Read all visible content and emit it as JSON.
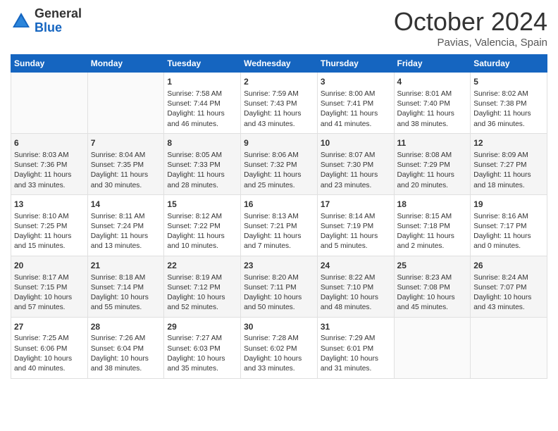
{
  "header": {
    "logo_general": "General",
    "logo_blue": "Blue",
    "month_title": "October 2024",
    "location": "Pavias, Valencia, Spain"
  },
  "days_of_week": [
    "Sunday",
    "Monday",
    "Tuesday",
    "Wednesday",
    "Thursday",
    "Friday",
    "Saturday"
  ],
  "weeks": [
    [
      {
        "day": "",
        "sunrise": "",
        "sunset": "",
        "daylight": ""
      },
      {
        "day": "",
        "sunrise": "",
        "sunset": "",
        "daylight": ""
      },
      {
        "day": "1",
        "sunrise": "Sunrise: 7:58 AM",
        "sunset": "Sunset: 7:44 PM",
        "daylight": "Daylight: 11 hours and 46 minutes."
      },
      {
        "day": "2",
        "sunrise": "Sunrise: 7:59 AM",
        "sunset": "Sunset: 7:43 PM",
        "daylight": "Daylight: 11 hours and 43 minutes."
      },
      {
        "day": "3",
        "sunrise": "Sunrise: 8:00 AM",
        "sunset": "Sunset: 7:41 PM",
        "daylight": "Daylight: 11 hours and 41 minutes."
      },
      {
        "day": "4",
        "sunrise": "Sunrise: 8:01 AM",
        "sunset": "Sunset: 7:40 PM",
        "daylight": "Daylight: 11 hours and 38 minutes."
      },
      {
        "day": "5",
        "sunrise": "Sunrise: 8:02 AM",
        "sunset": "Sunset: 7:38 PM",
        "daylight": "Daylight: 11 hours and 36 minutes."
      }
    ],
    [
      {
        "day": "6",
        "sunrise": "Sunrise: 8:03 AM",
        "sunset": "Sunset: 7:36 PM",
        "daylight": "Daylight: 11 hours and 33 minutes."
      },
      {
        "day": "7",
        "sunrise": "Sunrise: 8:04 AM",
        "sunset": "Sunset: 7:35 PM",
        "daylight": "Daylight: 11 hours and 30 minutes."
      },
      {
        "day": "8",
        "sunrise": "Sunrise: 8:05 AM",
        "sunset": "Sunset: 7:33 PM",
        "daylight": "Daylight: 11 hours and 28 minutes."
      },
      {
        "day": "9",
        "sunrise": "Sunrise: 8:06 AM",
        "sunset": "Sunset: 7:32 PM",
        "daylight": "Daylight: 11 hours and 25 minutes."
      },
      {
        "day": "10",
        "sunrise": "Sunrise: 8:07 AM",
        "sunset": "Sunset: 7:30 PM",
        "daylight": "Daylight: 11 hours and 23 minutes."
      },
      {
        "day": "11",
        "sunrise": "Sunrise: 8:08 AM",
        "sunset": "Sunset: 7:29 PM",
        "daylight": "Daylight: 11 hours and 20 minutes."
      },
      {
        "day": "12",
        "sunrise": "Sunrise: 8:09 AM",
        "sunset": "Sunset: 7:27 PM",
        "daylight": "Daylight: 11 hours and 18 minutes."
      }
    ],
    [
      {
        "day": "13",
        "sunrise": "Sunrise: 8:10 AM",
        "sunset": "Sunset: 7:25 PM",
        "daylight": "Daylight: 11 hours and 15 minutes."
      },
      {
        "day": "14",
        "sunrise": "Sunrise: 8:11 AM",
        "sunset": "Sunset: 7:24 PM",
        "daylight": "Daylight: 11 hours and 13 minutes."
      },
      {
        "day": "15",
        "sunrise": "Sunrise: 8:12 AM",
        "sunset": "Sunset: 7:22 PM",
        "daylight": "Daylight: 11 hours and 10 minutes."
      },
      {
        "day": "16",
        "sunrise": "Sunrise: 8:13 AM",
        "sunset": "Sunset: 7:21 PM",
        "daylight": "Daylight: 11 hours and 7 minutes."
      },
      {
        "day": "17",
        "sunrise": "Sunrise: 8:14 AM",
        "sunset": "Sunset: 7:19 PM",
        "daylight": "Daylight: 11 hours and 5 minutes."
      },
      {
        "day": "18",
        "sunrise": "Sunrise: 8:15 AM",
        "sunset": "Sunset: 7:18 PM",
        "daylight": "Daylight: 11 hours and 2 minutes."
      },
      {
        "day": "19",
        "sunrise": "Sunrise: 8:16 AM",
        "sunset": "Sunset: 7:17 PM",
        "daylight": "Daylight: 11 hours and 0 minutes."
      }
    ],
    [
      {
        "day": "20",
        "sunrise": "Sunrise: 8:17 AM",
        "sunset": "Sunset: 7:15 PM",
        "daylight": "Daylight: 10 hours and 57 minutes."
      },
      {
        "day": "21",
        "sunrise": "Sunrise: 8:18 AM",
        "sunset": "Sunset: 7:14 PM",
        "daylight": "Daylight: 10 hours and 55 minutes."
      },
      {
        "day": "22",
        "sunrise": "Sunrise: 8:19 AM",
        "sunset": "Sunset: 7:12 PM",
        "daylight": "Daylight: 10 hours and 52 minutes."
      },
      {
        "day": "23",
        "sunrise": "Sunrise: 8:20 AM",
        "sunset": "Sunset: 7:11 PM",
        "daylight": "Daylight: 10 hours and 50 minutes."
      },
      {
        "day": "24",
        "sunrise": "Sunrise: 8:22 AM",
        "sunset": "Sunset: 7:10 PM",
        "daylight": "Daylight: 10 hours and 48 minutes."
      },
      {
        "day": "25",
        "sunrise": "Sunrise: 8:23 AM",
        "sunset": "Sunset: 7:08 PM",
        "daylight": "Daylight: 10 hours and 45 minutes."
      },
      {
        "day": "26",
        "sunrise": "Sunrise: 8:24 AM",
        "sunset": "Sunset: 7:07 PM",
        "daylight": "Daylight: 10 hours and 43 minutes."
      }
    ],
    [
      {
        "day": "27",
        "sunrise": "Sunrise: 7:25 AM",
        "sunset": "Sunset: 6:06 PM",
        "daylight": "Daylight: 10 hours and 40 minutes."
      },
      {
        "day": "28",
        "sunrise": "Sunrise: 7:26 AM",
        "sunset": "Sunset: 6:04 PM",
        "daylight": "Daylight: 10 hours and 38 minutes."
      },
      {
        "day": "29",
        "sunrise": "Sunrise: 7:27 AM",
        "sunset": "Sunset: 6:03 PM",
        "daylight": "Daylight: 10 hours and 35 minutes."
      },
      {
        "day": "30",
        "sunrise": "Sunrise: 7:28 AM",
        "sunset": "Sunset: 6:02 PM",
        "daylight": "Daylight: 10 hours and 33 minutes."
      },
      {
        "day": "31",
        "sunrise": "Sunrise: 7:29 AM",
        "sunset": "Sunset: 6:01 PM",
        "daylight": "Daylight: 10 hours and 31 minutes."
      },
      {
        "day": "",
        "sunrise": "",
        "sunset": "",
        "daylight": ""
      },
      {
        "day": "",
        "sunrise": "",
        "sunset": "",
        "daylight": ""
      }
    ]
  ]
}
